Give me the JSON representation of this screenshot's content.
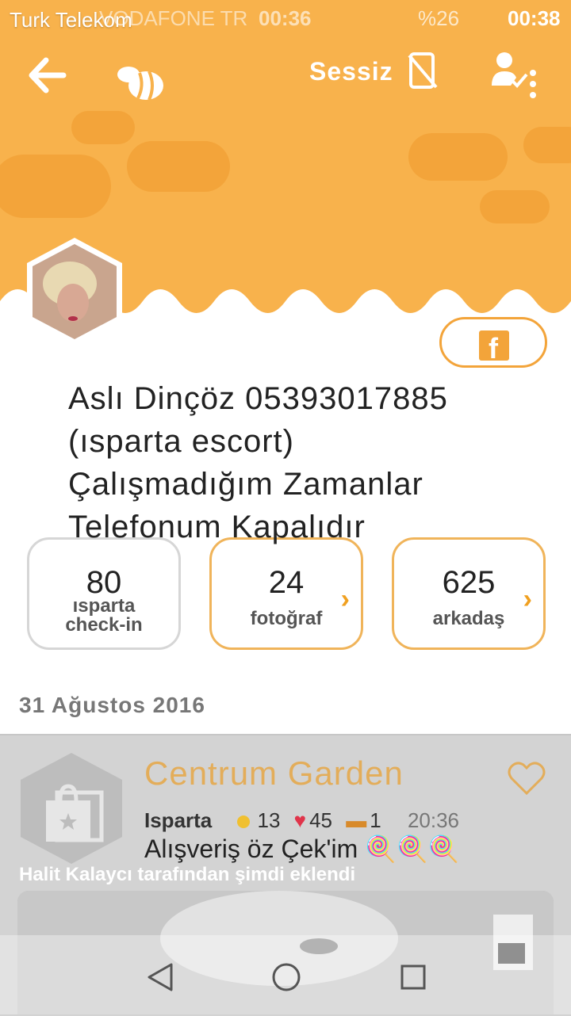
{
  "status_bar": {
    "carrier": "Turk Telekom",
    "carrier2": "VODAFONE TR",
    "time_left": "00:36",
    "battery": "%26",
    "time": "00:38"
  },
  "topbar": {
    "mute_label": "Sessiz"
  },
  "profile": {
    "name": "Aslı Dinçöz 05393017885 (ısparta escort) Çalışmadığım Zamanlar Telefonum Kapalıdır"
  },
  "stats": [
    {
      "value": "80",
      "label": "ısparta check-in"
    },
    {
      "value": "24",
      "label": "fotoğraf"
    },
    {
      "value": "625",
      "label": "arkadaş"
    }
  ],
  "feed": {
    "date": "31 Ağustos 2016",
    "venue": "Centrum Garden",
    "city": "Isparta",
    "coins": "13",
    "likes": "45",
    "comments": "1",
    "time": "20:36",
    "caption": "Alışveriş öz Çek'im 🍭🍭🍭",
    "added_by": "Halit Kalaycı tarafından şimdi eklendi"
  },
  "colors": {
    "header": "#f8b24c",
    "accent": "#f3a43a",
    "venue_text": "#e3ad5a"
  },
  "icons": [
    "back-arrow-icon",
    "swarm-bee-icon",
    "phone-mute-icon",
    "user-check-icon",
    "more-vert-icon",
    "facebook-icon",
    "shopping-bag-icon",
    "heart-outline-icon",
    "back-triangle-icon",
    "home-circle-icon",
    "recents-square-icon"
  ]
}
